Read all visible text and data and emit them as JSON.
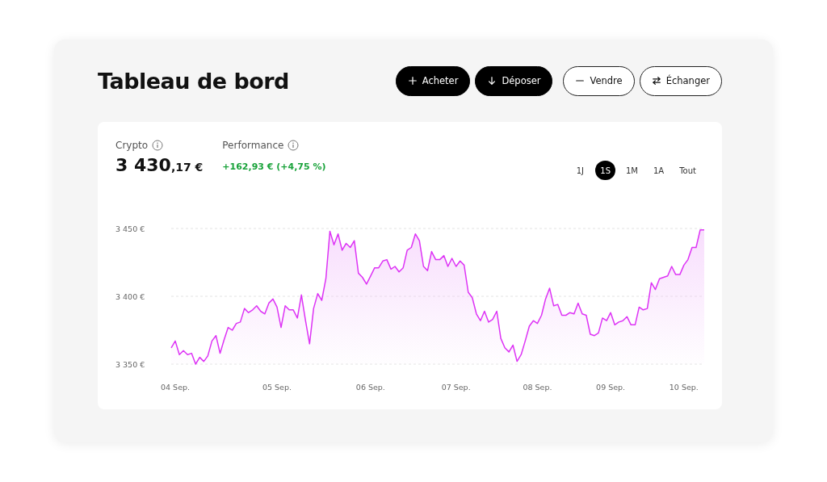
{
  "title": "Tableau de bord",
  "actions": [
    {
      "label": "Acheter",
      "kind": "plus"
    },
    {
      "label": "Déposer",
      "kind": "down"
    },
    {
      "label": "Vendre",
      "kind": "minus"
    },
    {
      "label": "Échanger",
      "kind": "swap"
    }
  ],
  "stats": [
    {
      "label": "Crypto",
      "value_main": "3 430",
      "value_decimals": ",17 €",
      "kind": "amount"
    },
    {
      "label": "Performance",
      "value": "+162,93 € (+4,75 %)",
      "kind": "change"
    }
  ],
  "periods": [
    {
      "label": "1J",
      "selected": false
    },
    {
      "label": "1S",
      "selected": true
    },
    {
      "label": "1M",
      "selected": false
    },
    {
      "label": "1A",
      "selected": false
    },
    {
      "label": "Tout",
      "selected": false
    }
  ],
  "chart_data": {
    "type": "area",
    "ylim": [
      3350,
      3450
    ],
    "yticks": [
      {
        "value": 3350,
        "label": "3 350 €"
      },
      {
        "value": 3400,
        "label": "3 400 €"
      },
      {
        "value": 3450,
        "label": "3 450 €"
      }
    ],
    "categories": [
      null,
      "04 Sep.",
      null,
      null,
      null,
      null,
      null,
      null,
      null,
      null,
      null,
      null,
      null,
      null,
      null,
      null,
      null,
      null,
      null,
      null,
      null,
      null,
      null,
      null,
      null,
      null,
      "05 Sep.",
      null,
      null,
      null,
      null,
      null,
      null,
      null,
      null,
      null,
      null,
      null,
      null,
      null,
      null,
      null,
      null,
      null,
      null,
      null,
      null,
      null,
      null,
      "06 Sep.",
      null,
      null,
      null,
      null,
      null,
      null,
      null,
      null,
      null,
      null,
      null,
      null,
      null,
      null,
      null,
      null,
      null,
      null,
      null,
      null,
      "07 Sep.",
      null,
      null,
      null,
      null,
      null,
      null,
      null,
      null,
      null,
      null,
      null,
      null,
      null,
      null,
      null,
      null,
      null,
      null,
      null,
      "08 Sep.",
      null,
      null,
      null,
      null,
      null,
      null,
      null,
      null,
      null,
      null,
      null,
      null,
      null,
      null,
      null,
      null,
      null,
      "09 Sep.",
      null,
      null,
      null,
      null,
      null,
      null,
      null,
      null,
      null,
      null,
      null,
      null,
      null,
      null,
      null,
      null,
      null,
      "10 Sep.",
      null,
      null,
      null,
      null,
      null
    ],
    "series": [
      {
        "color": "#dd33f5",
        "values": [
          3362,
          3367,
          3357,
          3360,
          3357,
          3358,
          3350,
          3355,
          3352,
          3356,
          3367,
          3371,
          3358,
          3368,
          3377,
          3375,
          3380,
          3381,
          3391,
          3388,
          3390,
          3393,
          3389,
          3387,
          3395,
          3398,
          3392,
          3377,
          3393,
          3390,
          3390,
          3384,
          3401,
          3382,
          3365,
          3391,
          3402,
          3397,
          3413,
          3448,
          3438,
          3446,
          3434,
          3439,
          3436,
          3441,
          3417,
          3414,
          3409,
          3415,
          3421,
          3421,
          3426,
          3427,
          3420,
          3422,
          3418,
          3421,
          3434,
          3436,
          3446,
          3441,
          3422,
          3419,
          3433,
          3427,
          3427,
          3430,
          3422,
          3428,
          3422,
          3426,
          3423,
          3403,
          3399,
          3387,
          3382,
          3389,
          3381,
          3383,
          3389,
          3369,
          3362,
          3359,
          3364,
          3352,
          3357,
          3367,
          3378,
          3382,
          3380,
          3386,
          3398,
          3406,
          3393,
          3394,
          3386,
          3386,
          3388,
          3387,
          3395,
          3387,
          3386,
          3372,
          3371,
          3373,
          3384,
          3382,
          3388,
          3379,
          3381,
          3382,
          3385,
          3379,
          3379,
          3392,
          3390,
          3391,
          3410,
          3405,
          3413,
          3414,
          3415,
          3422,
          3416,
          3416,
          3423,
          3427,
          3436,
          3436,
          3449,
          3449
        ]
      }
    ]
  }
}
